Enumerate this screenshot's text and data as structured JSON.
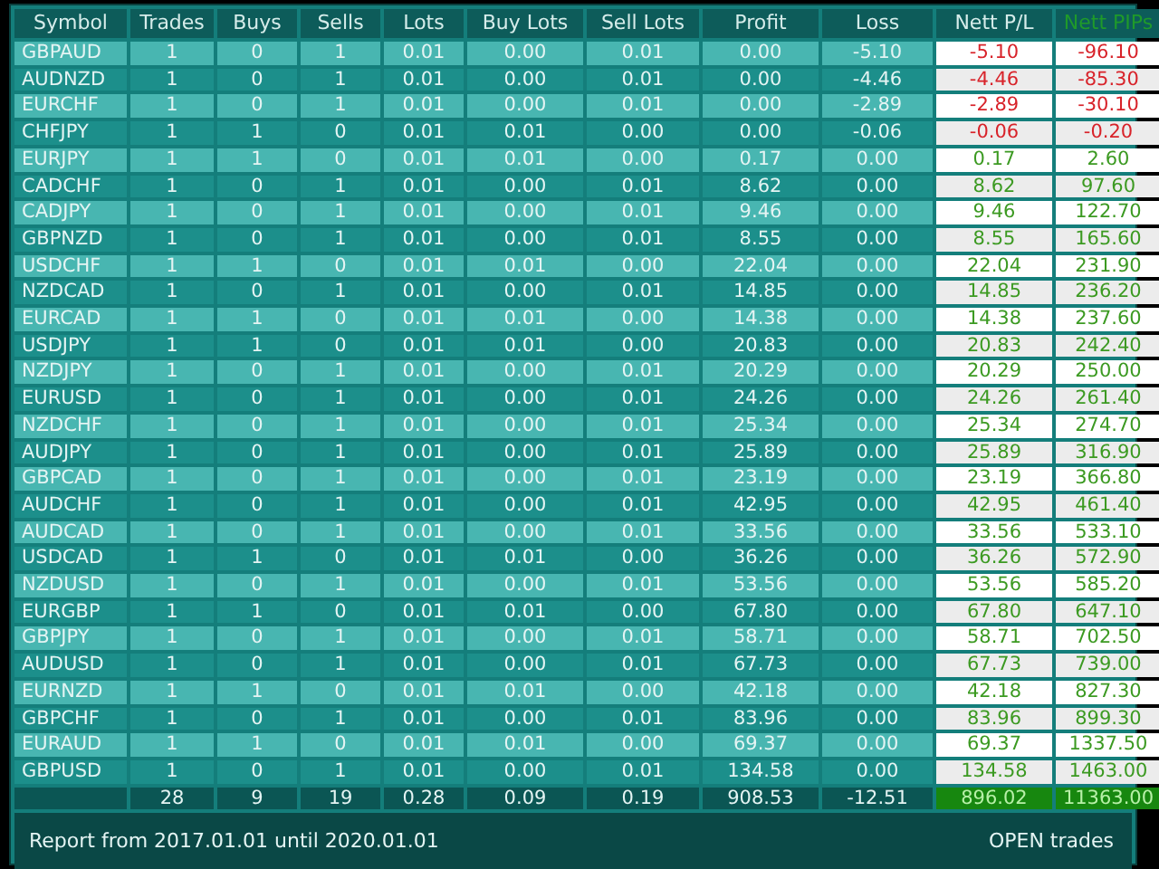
{
  "table": {
    "columns": [
      "Symbol",
      "Trades",
      "Buys",
      "Sells",
      "Lots",
      "Buy Lots",
      "Sell Lots",
      "Profit",
      "Loss",
      "Nett P/L",
      "Nett PIPs"
    ],
    "rows": [
      {
        "cells": [
          "GBPAUD",
          "1",
          "0",
          "1",
          "0.01",
          "0.00",
          "0.01",
          "0.00",
          "-5.10",
          "-5.10",
          "-96.10"
        ],
        "negative": true
      },
      {
        "cells": [
          "AUDNZD",
          "1",
          "0",
          "1",
          "0.01",
          "0.00",
          "0.01",
          "0.00",
          "-4.46",
          "-4.46",
          "-85.30"
        ],
        "negative": true
      },
      {
        "cells": [
          "EURCHF",
          "1",
          "0",
          "1",
          "0.01",
          "0.00",
          "0.01",
          "0.00",
          "-2.89",
          "-2.89",
          "-30.10"
        ],
        "negative": true
      },
      {
        "cells": [
          "CHFJPY",
          "1",
          "1",
          "0",
          "0.01",
          "0.01",
          "0.00",
          "0.00",
          "-0.06",
          "-0.06",
          "-0.20"
        ],
        "negative": true
      },
      {
        "cells": [
          "EURJPY",
          "1",
          "1",
          "0",
          "0.01",
          "0.01",
          "0.00",
          "0.17",
          "0.00",
          "0.17",
          "2.60"
        ],
        "negative": false
      },
      {
        "cells": [
          "CADCHF",
          "1",
          "0",
          "1",
          "0.01",
          "0.00",
          "0.01",
          "8.62",
          "0.00",
          "8.62",
          "97.60"
        ],
        "negative": false
      },
      {
        "cells": [
          "CADJPY",
          "1",
          "0",
          "1",
          "0.01",
          "0.00",
          "0.01",
          "9.46",
          "0.00",
          "9.46",
          "122.70"
        ],
        "negative": false
      },
      {
        "cells": [
          "GBPNZD",
          "1",
          "0",
          "1",
          "0.01",
          "0.00",
          "0.01",
          "8.55",
          "0.00",
          "8.55",
          "165.60"
        ],
        "negative": false
      },
      {
        "cells": [
          "USDCHF",
          "1",
          "1",
          "0",
          "0.01",
          "0.01",
          "0.00",
          "22.04",
          "0.00",
          "22.04",
          "231.90"
        ],
        "negative": false
      },
      {
        "cells": [
          "NZDCAD",
          "1",
          "0",
          "1",
          "0.01",
          "0.00",
          "0.01",
          "14.85",
          "0.00",
          "14.85",
          "236.20"
        ],
        "negative": false
      },
      {
        "cells": [
          "EURCAD",
          "1",
          "1",
          "0",
          "0.01",
          "0.01",
          "0.00",
          "14.38",
          "0.00",
          "14.38",
          "237.60"
        ],
        "negative": false
      },
      {
        "cells": [
          "USDJPY",
          "1",
          "1",
          "0",
          "0.01",
          "0.01",
          "0.00",
          "20.83",
          "0.00",
          "20.83",
          "242.40"
        ],
        "negative": false
      },
      {
        "cells": [
          "NZDJPY",
          "1",
          "0",
          "1",
          "0.01",
          "0.00",
          "0.01",
          "20.29",
          "0.00",
          "20.29",
          "250.00"
        ],
        "negative": false
      },
      {
        "cells": [
          "EURUSD",
          "1",
          "0",
          "1",
          "0.01",
          "0.00",
          "0.01",
          "24.26",
          "0.00",
          "24.26",
          "261.40"
        ],
        "negative": false
      },
      {
        "cells": [
          "NZDCHF",
          "1",
          "0",
          "1",
          "0.01",
          "0.00",
          "0.01",
          "25.34",
          "0.00",
          "25.34",
          "274.70"
        ],
        "negative": false
      },
      {
        "cells": [
          "AUDJPY",
          "1",
          "0",
          "1",
          "0.01",
          "0.00",
          "0.01",
          "25.89",
          "0.00",
          "25.89",
          "316.90"
        ],
        "negative": false
      },
      {
        "cells": [
          "GBPCAD",
          "1",
          "0",
          "1",
          "0.01",
          "0.00",
          "0.01",
          "23.19",
          "0.00",
          "23.19",
          "366.80"
        ],
        "negative": false
      },
      {
        "cells": [
          "AUDCHF",
          "1",
          "0",
          "1",
          "0.01",
          "0.00",
          "0.01",
          "42.95",
          "0.00",
          "42.95",
          "461.40"
        ],
        "negative": false
      },
      {
        "cells": [
          "AUDCAD",
          "1",
          "0",
          "1",
          "0.01",
          "0.00",
          "0.01",
          "33.56",
          "0.00",
          "33.56",
          "533.10"
        ],
        "negative": false
      },
      {
        "cells": [
          "USDCAD",
          "1",
          "1",
          "0",
          "0.01",
          "0.01",
          "0.00",
          "36.26",
          "0.00",
          "36.26",
          "572.90"
        ],
        "negative": false
      },
      {
        "cells": [
          "NZDUSD",
          "1",
          "0",
          "1",
          "0.01",
          "0.00",
          "0.01",
          "53.56",
          "0.00",
          "53.56",
          "585.20"
        ],
        "negative": false
      },
      {
        "cells": [
          "EURGBP",
          "1",
          "1",
          "0",
          "0.01",
          "0.01",
          "0.00",
          "67.80",
          "0.00",
          "67.80",
          "647.10"
        ],
        "negative": false
      },
      {
        "cells": [
          "GBPJPY",
          "1",
          "0",
          "1",
          "0.01",
          "0.00",
          "0.01",
          "58.71",
          "0.00",
          "58.71",
          "702.50"
        ],
        "negative": false
      },
      {
        "cells": [
          "AUDUSD",
          "1",
          "0",
          "1",
          "0.01",
          "0.00",
          "0.01",
          "67.73",
          "0.00",
          "67.73",
          "739.00"
        ],
        "negative": false
      },
      {
        "cells": [
          "EURNZD",
          "1",
          "1",
          "0",
          "0.01",
          "0.01",
          "0.00",
          "42.18",
          "0.00",
          "42.18",
          "827.30"
        ],
        "negative": false
      },
      {
        "cells": [
          "GBPCHF",
          "1",
          "0",
          "1",
          "0.01",
          "0.00",
          "0.01",
          "83.96",
          "0.00",
          "83.96",
          "899.30"
        ],
        "negative": false
      },
      {
        "cells": [
          "EURAUD",
          "1",
          "1",
          "0",
          "0.01",
          "0.01",
          "0.00",
          "69.37",
          "0.00",
          "69.37",
          "1337.50"
        ],
        "negative": false
      },
      {
        "cells": [
          "GBPUSD",
          "1",
          "0",
          "1",
          "0.01",
          "0.00",
          "0.01",
          "134.58",
          "0.00",
          "134.58",
          "1463.00"
        ],
        "negative": false
      }
    ],
    "totals": [
      "28",
      "9",
      "19",
      "0.28",
      "0.09",
      "0.19",
      "908.53",
      "-12.51",
      "896.02",
      "11363.00"
    ]
  },
  "footer": {
    "report_range": "Report from 2017.01.01 until 2020.01.01",
    "mode": "OPEN trades"
  }
}
